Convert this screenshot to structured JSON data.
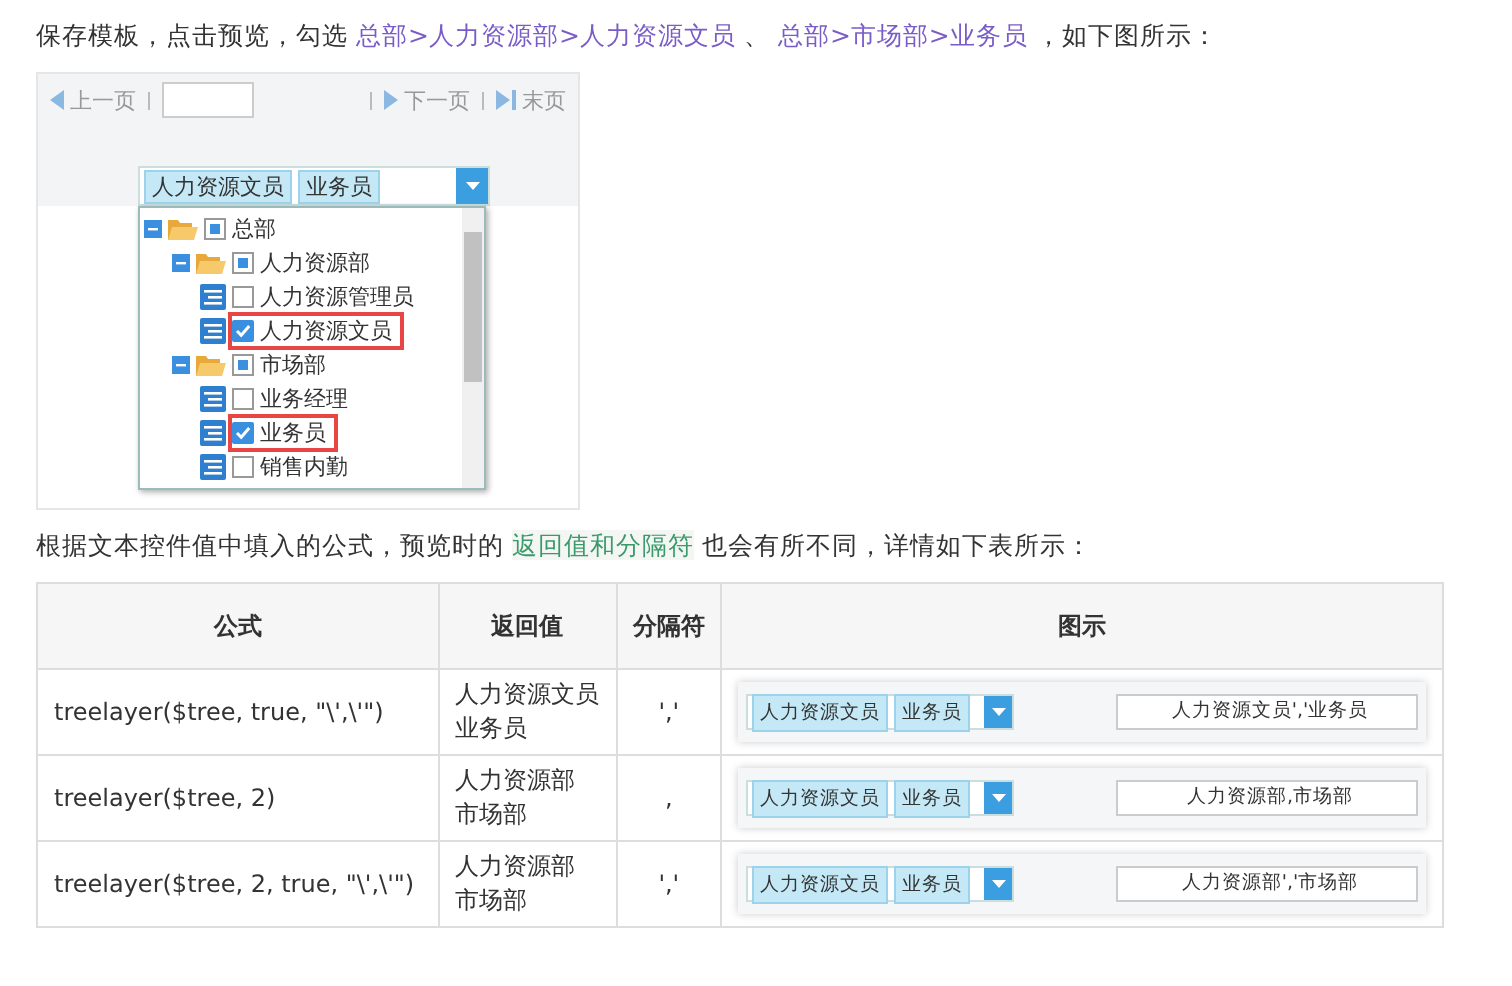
{
  "intro": {
    "text": "保存模板，点击预览，勾选",
    "links": [
      "总部>人力资源部>人力资源文员",
      "总部>市场部>业务员"
    ],
    "separator": "、",
    "tail": "，如下图所示："
  },
  "preview": {
    "pager": {
      "prev": "上一页",
      "next": "下一页",
      "last": "末页"
    },
    "tags": [
      "人力资源文员",
      "业务员"
    ],
    "tree": [
      {
        "label": "总部",
        "kind": "folder",
        "expanded": true,
        "checked": false,
        "partial": true,
        "highlighted": false,
        "children": [
          {
            "label": "人力资源部",
            "kind": "folder",
            "expanded": true,
            "checked": false,
            "partial": true,
            "highlighted": false,
            "children": [
              {
                "label": "人力资源管理员",
                "kind": "leaf",
                "checked": false,
                "partial": false,
                "highlighted": false
              },
              {
                "label": "人力资源文员",
                "kind": "leaf",
                "checked": true,
                "partial": false,
                "highlighted": true
              }
            ]
          },
          {
            "label": "市场部",
            "kind": "folder",
            "expanded": true,
            "checked": false,
            "partial": true,
            "highlighted": false,
            "children": [
              {
                "label": "业务经理",
                "kind": "leaf",
                "checked": false,
                "partial": false,
                "highlighted": false
              },
              {
                "label": "业务员",
                "kind": "leaf",
                "checked": true,
                "partial": false,
                "highlighted": true
              },
              {
                "label": "销售内勤",
                "kind": "leaf",
                "checked": false,
                "partial": false,
                "highlighted": false
              }
            ]
          }
        ]
      }
    ]
  },
  "para2": {
    "text": "根据文本控件值中填入的公式，预览时的",
    "highlight": "返回值和分隔符",
    "tail": "也会有所不同，详情如下表所示："
  },
  "table": {
    "columns": [
      "公式",
      "返回值",
      "分隔符",
      "图示"
    ],
    "rows": [
      {
        "formula": "treelayer($tree, true, \"\\',\\'\")",
        "returns": [
          "人力资源文员",
          "业务员"
        ],
        "separator": "','",
        "tags": [
          "人力资源文员",
          "业务员"
        ],
        "result": "人力资源文员','业务员"
      },
      {
        "formula": "treelayer($tree, 2)",
        "returns": [
          "人力资源部",
          "市场部"
        ],
        "separator": ",",
        "tags": [
          "人力资源文员",
          "业务员"
        ],
        "result": "人力资源部,市场部"
      },
      {
        "formula": "treelayer($tree, 2, true, \"\\',\\'\")",
        "returns": [
          "人力资源部",
          "市场部"
        ],
        "separator": "','",
        "tags": [
          "人力资源文员",
          "业务员"
        ],
        "result": "人力资源部','市场部"
      }
    ]
  }
}
